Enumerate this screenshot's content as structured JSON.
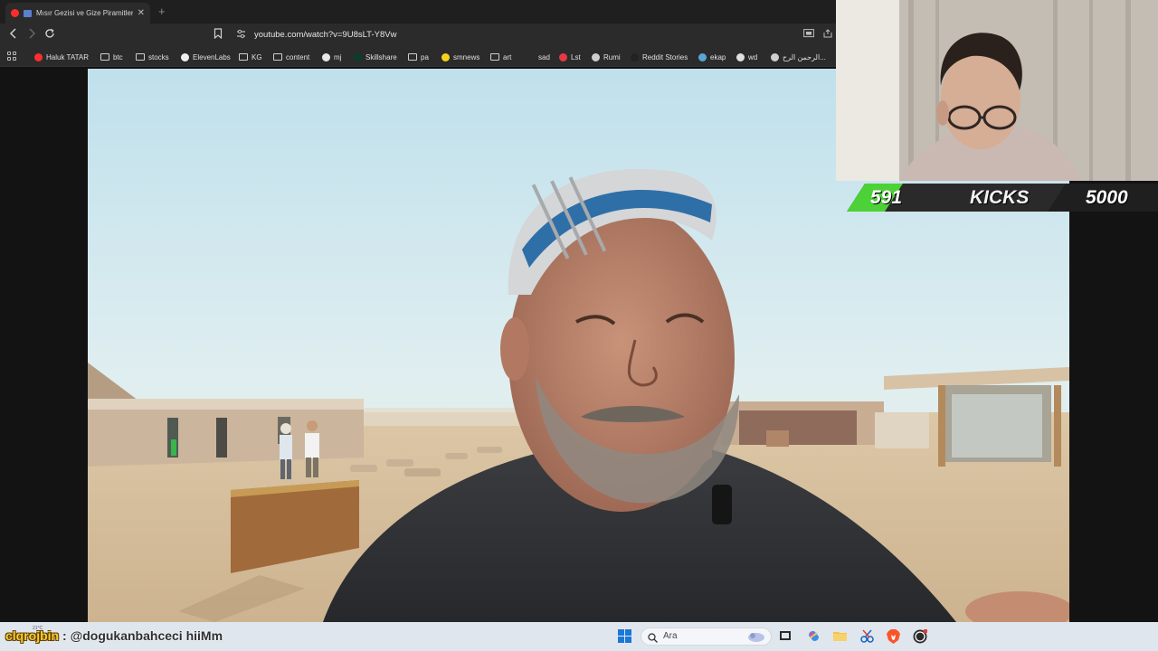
{
  "browser": {
    "tab": {
      "title": "Mısır Gezisi ve Gize Piramitleri",
      "close": "✕"
    },
    "new_tab": "+",
    "url": "youtube.com/watch?v=9U8sLT-Y8Vw",
    "bookmarks": [
      {
        "label": "Haluk TATAR",
        "icon": "youtube-icon"
      },
      {
        "label": "btc",
        "icon": "folder-icon"
      },
      {
        "label": "stocks",
        "icon": "folder-icon"
      },
      {
        "label": "ElevenLabs",
        "icon": "elevenlabs-icon"
      },
      {
        "label": "KG",
        "icon": "folder-icon"
      },
      {
        "label": "content",
        "icon": "folder-icon"
      },
      {
        "label": "mj",
        "icon": "github-icon"
      },
      {
        "label": "Skillshare",
        "icon": "skillshare-icon"
      },
      {
        "label": "pa",
        "icon": "folder-icon"
      },
      {
        "label": "smnews",
        "icon": "smiley-icon"
      },
      {
        "label": "art",
        "icon": "folder-icon"
      },
      {
        "label": "sad",
        "icon": "backslash-icon"
      },
      {
        "label": "Lst",
        "icon": "s-logo-icon"
      },
      {
        "label": "Rumi",
        "icon": "globe-icon"
      },
      {
        "label": "Reddit Stories",
        "icon": "d-logo-icon"
      },
      {
        "label": "ekap",
        "icon": "bird-icon"
      },
      {
        "label": "wd",
        "icon": "wikipedia-icon"
      },
      {
        "label": "الرحمن الرح...",
        "icon": "page-icon"
      }
    ]
  },
  "overlay": {
    "count_left": "591",
    "label": "KICKS",
    "count_right": "5000"
  },
  "chat": {
    "user": "clqrojbin",
    "separator": " : ",
    "message": "@dogukanbahceci hiiMm",
    "temp": "21°C"
  },
  "taskbar": {
    "search_placeholder": "Ara"
  },
  "colors": {
    "accent_green": "#4cd137",
    "bar_dark": "#2a2a2a"
  }
}
